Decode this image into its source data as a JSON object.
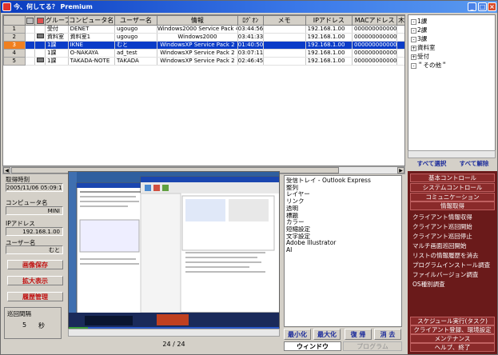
{
  "window": {
    "title": "今、何してる？ Premium"
  },
  "table": {
    "columns": [
      "",
      "",
      "",
      "グループ",
      "コンピュータ名",
      "ユーザー名",
      "情報",
      "ﾛｸﾞｵﾝ",
      "メモ",
      "IPアドレス",
      "MACアドレス",
      "木"
    ],
    "rows": [
      {
        "n": "1",
        "group": "受付",
        "computer": "DENET",
        "user": "ugougo",
        "info": "Windows2000 Service Pack 4",
        "logon": "03:44:56",
        "memo": "",
        "ip": "192.168.1.00",
        "mac": "000000000000"
      },
      {
        "n": "2",
        "group": "資料室",
        "computer": "資料室1",
        "user": "ugougo",
        "info": "Windows2000",
        "logon": "03:41:33",
        "memo": "",
        "ip": "192.168.1.00",
        "mac": "000000000000"
      },
      {
        "n": "3",
        "group": "1課",
        "computer": "IKNE",
        "user": "むと",
        "info": "WindowsXP Service Pack 2",
        "logon": "01:40:50",
        "memo": "",
        "ip": "192.168.1.00",
        "mac": "000000000000"
      },
      {
        "n": "4",
        "group": "1課",
        "computer": "O-NAKAYA",
        "user": "ad_test",
        "info": "WindowsXP Service Pack 2",
        "logon": "03:07:11",
        "memo": "",
        "ip": "192.168.1.00",
        "mac": "000000000000"
      },
      {
        "n": "5",
        "group": "1課",
        "computer": "TAKADA-NOTE",
        "user": "TAKADA",
        "info": "WindowsXP Service Pack 2",
        "logon": "02:46:45",
        "memo": "",
        "ip": "192.168.1.00",
        "mac": "000000000000"
      }
    ]
  },
  "tree": {
    "items": [
      "1課",
      "2課",
      "3課",
      "資料室",
      "受付",
      "＂その他＂"
    ]
  },
  "tree_buttons": {
    "select_all": "すべて選択",
    "deselect_all": "すべて解除"
  },
  "info": {
    "fetch_time_label": "取得時刻",
    "fetch_time": "2005/11/06 05:09:11",
    "computer_label": "コンピュータ名",
    "computer": "MINI",
    "ip_label": "IPアドレス",
    "ip": "192.168.1.00",
    "user_label": "ユーザー名",
    "user": "むと",
    "save_image": "画像保存",
    "enlarge": "拡大表示",
    "history": "履歴管理",
    "interval_label": "巡回間隔",
    "interval_value": "5",
    "interval_unit": "秒"
  },
  "screenshot": {
    "caption": "24 / 24"
  },
  "windows": {
    "items": [
      "受信トレイ - Outlook Express",
      "整列",
      "レイヤー",
      "リンク",
      "透明",
      "標題",
      "カラー",
      "短縮設定",
      "文字設定",
      "Adobe Illustrator",
      "AI"
    ]
  },
  "window_buttons": {
    "minimize": "最小化",
    "maximize": "最大化",
    "restore": "復 帰",
    "close": "消 去"
  },
  "tabs": {
    "window": "ウィンドウ",
    "program": "プログラム"
  },
  "menu": {
    "headers": [
      "基本コントロール",
      "システムコントロール",
      "コミュニケーション",
      "情報取得"
    ],
    "items": [
      "クライアント情報収得",
      "クライアント巡回開始",
      "クライアント巡回停止",
      "マルチ画面巡回開始",
      "リストの情報履歴を消去",
      "プログラムインストール調査",
      "ファイルバージョン調査",
      "OS種別調査"
    ],
    "footer": [
      "スケジュール実行(タスク)",
      "クライアント登録、環境設定",
      "メンテナンス",
      "ヘルプ、終了"
    ]
  },
  "colors": {
    "selection": "#0a3cc8",
    "titlebar": "#0a3cbf",
    "menu_bg": "#6a1a1a",
    "accent_red": "#c01010"
  }
}
